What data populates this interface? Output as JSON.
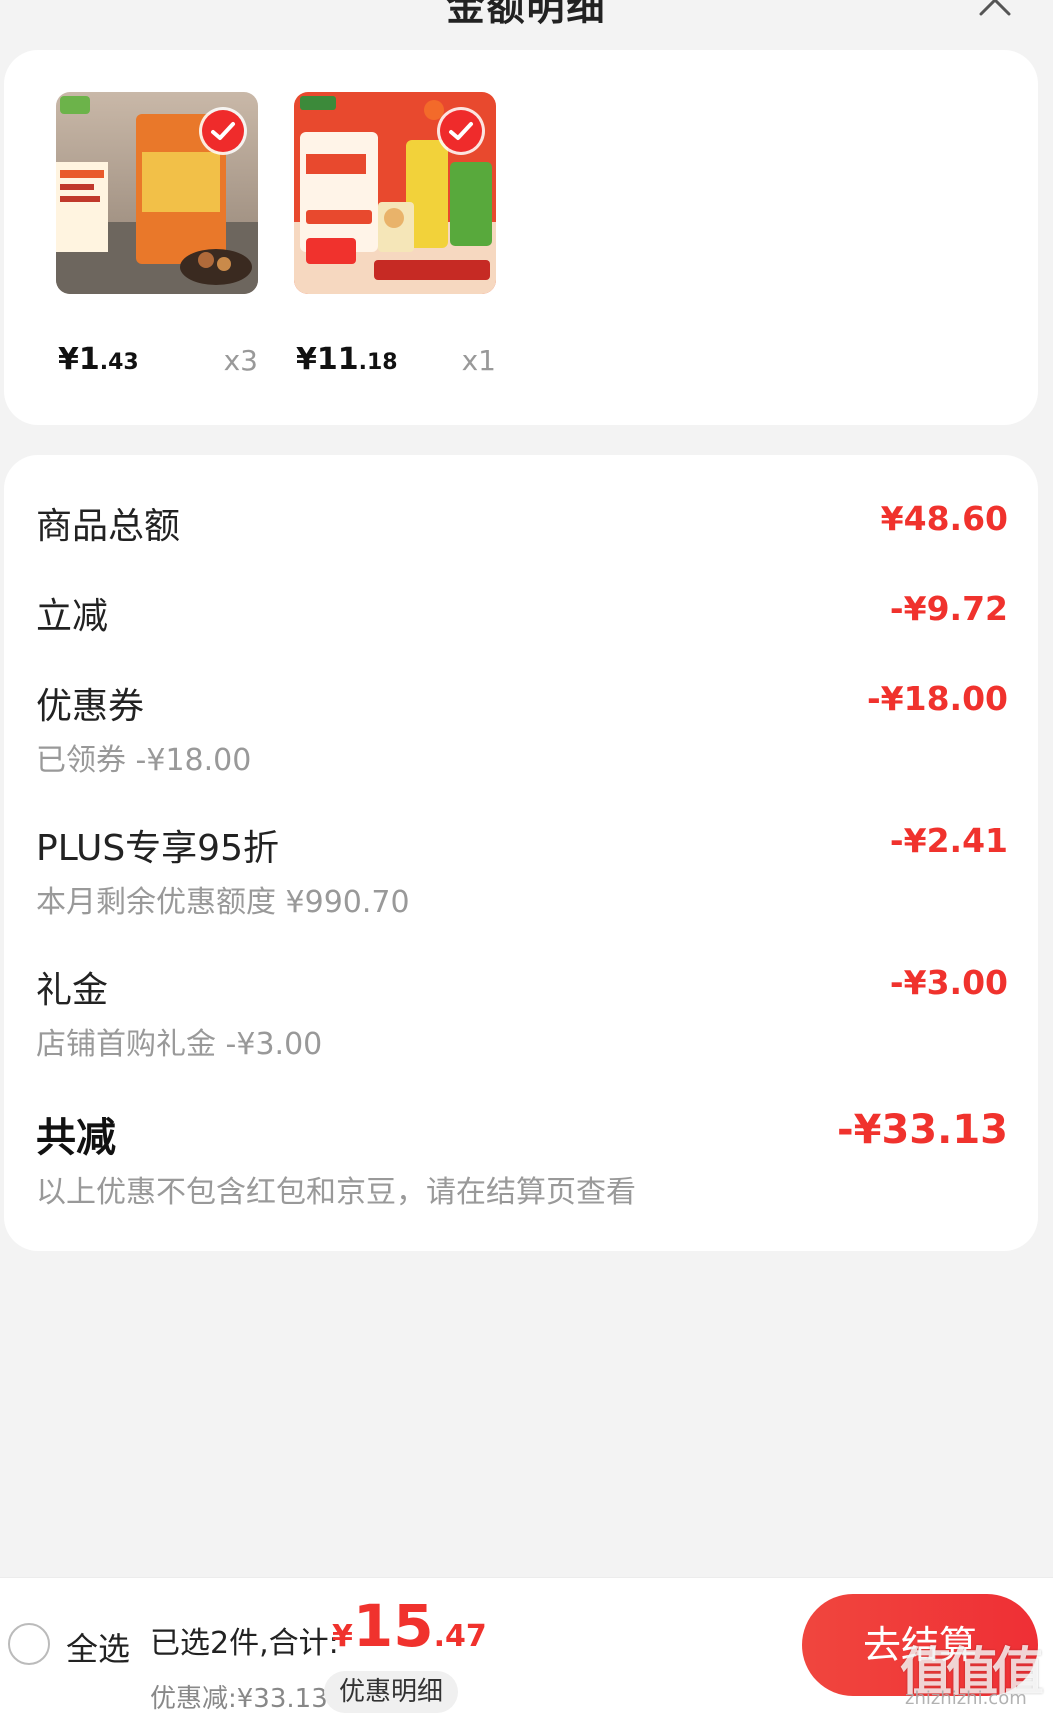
{
  "header": {
    "title": "金额明细"
  },
  "products": [
    {
      "price_yen": "¥",
      "price_int": "1",
      "price_dec": ".43",
      "qty": "x3",
      "selected": true
    },
    {
      "price_yen": "¥",
      "price_int": "11",
      "price_dec": ".18",
      "qty": "x1",
      "selected": true
    }
  ],
  "breakdown": {
    "subtotal": {
      "label": "商品总额",
      "amount": "¥48.60"
    },
    "instant_discount": {
      "label": "立减",
      "amount": "-¥9.72"
    },
    "coupon": {
      "label": "优惠券",
      "sub": "已领券 -¥18.00",
      "amount": "-¥18.00"
    },
    "plus": {
      "label": "PLUS专享95折",
      "sub": "本月剩余优惠额度 ¥990.70",
      "amount": "-¥2.41"
    },
    "gift": {
      "label": "礼金",
      "sub": "店铺首购礼金 -¥3.00",
      "amount": "-¥3.00"
    },
    "total_discount": {
      "label": "共减",
      "sub": "以上优惠不包含红包和京豆，请在结算页查看",
      "amount": "-¥33.13"
    }
  },
  "bottom_bar": {
    "select_all": "全选",
    "selected_summary": "已选2件,合计:",
    "total_yen": "¥",
    "total_int": "15",
    "total_dec": ".47",
    "discount_sum": "优惠减:¥33.13",
    "details_button": "优惠明细",
    "checkout_button": "去结算"
  },
  "watermark": {
    "text": "值值值",
    "url": "zhizhizhi.com"
  },
  "colors": {
    "accent_red": "#f0322d",
    "background": "#f3f3f3",
    "card": "#ffffff"
  }
}
